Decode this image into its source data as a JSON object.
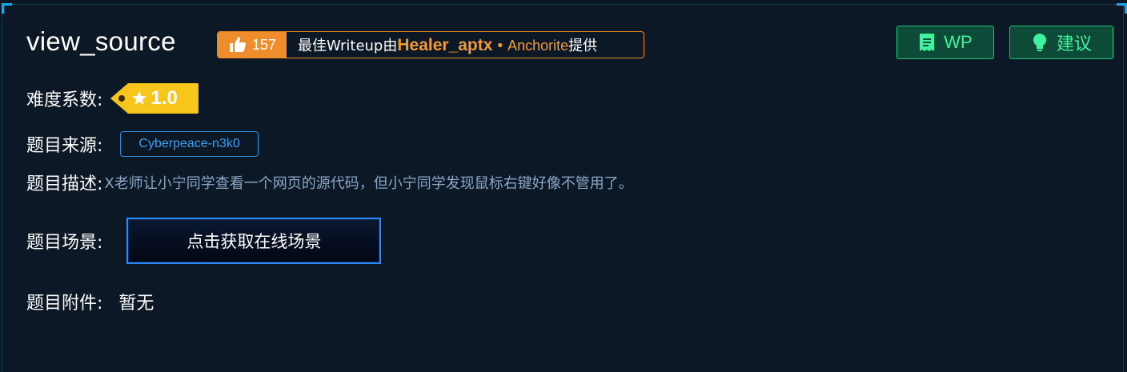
{
  "challenge": {
    "title": "view_source"
  },
  "writeup": {
    "likes": "157",
    "prefix": "最佳Writeup由",
    "author": "Healer_aptx",
    "dot": "•",
    "provider": "Anchorite",
    "suffix": "提供"
  },
  "actions": {
    "wp_label": "WP",
    "suggest_label": "建议"
  },
  "info": {
    "difficulty_label": "难度系数:",
    "difficulty_value": "1.0",
    "source_label": "题目来源:",
    "source_value": "Cyberpeace-n3k0",
    "description_label": "题目描述:",
    "description_value": "X老师让小宁同学查看一个网页的源代码，但小宁同学发现鼠标右键好像不管用了。",
    "scene_label": "题目场景:",
    "scene_button": "点击获取在线场景",
    "attachment_label": "题目附件:",
    "attachment_value": "暂无"
  },
  "colors": {
    "background": "#0c1826",
    "accent_orange": "#ef8c2c",
    "accent_green": "#3ff2a0",
    "accent_blue": "#2c8cff",
    "difficulty_yellow": "#f8c61a"
  },
  "icons": {
    "like": "thumbs-up-icon",
    "wp": "document-icon",
    "suggest": "lightbulb-icon",
    "difficulty": "star-icon"
  }
}
